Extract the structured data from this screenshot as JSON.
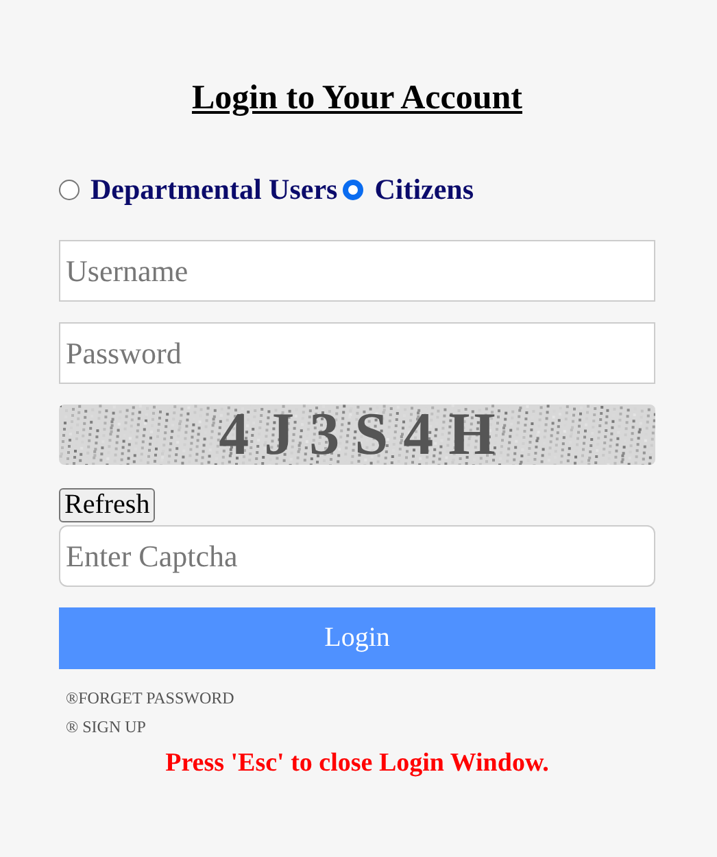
{
  "title": "Login to Your Account",
  "user_types": [
    {
      "label": "Departmental Users",
      "selected": false
    },
    {
      "label": "Citizens",
      "selected": true
    }
  ],
  "username": {
    "placeholder": "Username"
  },
  "password": {
    "placeholder": "Password"
  },
  "captcha": {
    "text": "4 J 3 S 4 H"
  },
  "refresh_button": "Refresh",
  "captcha_input": {
    "placeholder": "Enter Captcha"
  },
  "login_button": "Login",
  "links": [
    "®FORGET PASSWORD",
    "® SIGN UP"
  ],
  "note": "Press 'Esc' to close Login Window."
}
